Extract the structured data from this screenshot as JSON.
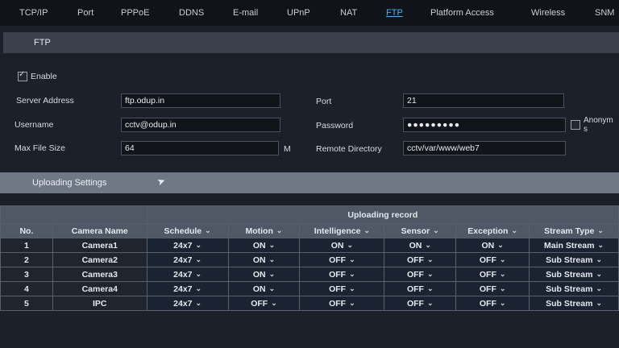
{
  "tabs": [
    {
      "label": "TCP/IP"
    },
    {
      "label": "Port"
    },
    {
      "label": "PPPoE"
    },
    {
      "label": "DDNS"
    },
    {
      "label": "E-mail"
    },
    {
      "label": "UPnP"
    },
    {
      "label": "NAT"
    },
    {
      "label": "FTP"
    },
    {
      "label": "Platform Access"
    },
    {
      "label": "Wireless"
    },
    {
      "label": "SNM"
    }
  ],
  "ftp": {
    "section_title": "FTP",
    "enable_label": "Enable",
    "enabled": true,
    "server_address_label": "Server Address",
    "server_address": "ftp.odup.in",
    "port_label": "Port",
    "port": "21",
    "username_label": "Username",
    "username": "cctv@odup.in",
    "password_label": "Password",
    "password": "●●●●●●●●●",
    "anonymous_label": "Anonym",
    "anonymous_label_wrap": "s",
    "anonymous": false,
    "max_file_size_label": "Max File Size",
    "max_file_size": "64",
    "max_file_size_unit": "M",
    "remote_directory_label": "Remote Directory",
    "remote_directory": "cctv/var/www/web7"
  },
  "uploading": {
    "section_title": "Uploading Settings",
    "group_header": "Uploading record",
    "columns": [
      "No.",
      "Camera Name",
      "Schedule",
      "Motion",
      "Intelligence",
      "Sensor",
      "Exception",
      "Stream Type"
    ],
    "rows": [
      [
        "1",
        "Camera1",
        "24x7",
        "ON",
        "ON",
        "ON",
        "ON",
        "Main Stream"
      ],
      [
        "2",
        "Camera2",
        "24x7",
        "ON",
        "OFF",
        "OFF",
        "OFF",
        "Sub Stream"
      ],
      [
        "3",
        "Camera3",
        "24x7",
        "ON",
        "OFF",
        "OFF",
        "OFF",
        "Sub Stream"
      ],
      [
        "4",
        "Camera4",
        "24x7",
        "ON",
        "OFF",
        "OFF",
        "OFF",
        "Sub Stream"
      ],
      [
        "5",
        "IPC",
        "24x7",
        "OFF",
        "OFF",
        "OFF",
        "OFF",
        "Sub Stream"
      ]
    ]
  },
  "icons": {
    "checkbox": "checkbox-icon",
    "chevron": "chevron-down-icon",
    "cursor": "mouse-cursor-icon"
  }
}
